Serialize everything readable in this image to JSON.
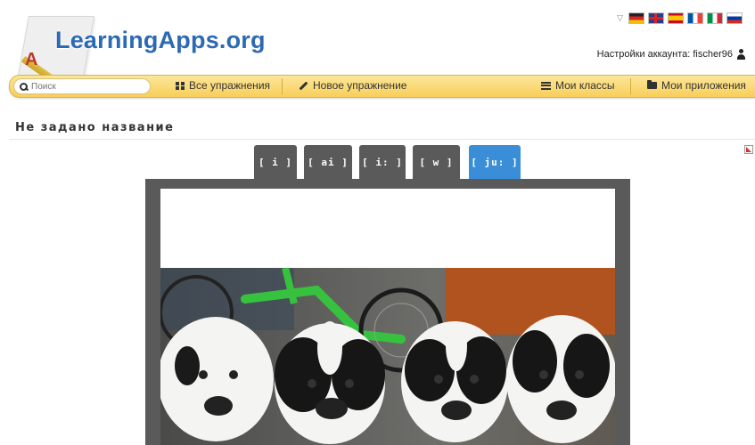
{
  "header": {
    "logo_text": "LearningApps.org",
    "account_label": "Настройки аккаунта: fischer96",
    "languages": [
      "de",
      "en",
      "es",
      "fr",
      "it",
      "ru"
    ]
  },
  "nav": {
    "search_placeholder": "Поиск",
    "all_exercises": "Все упражнения",
    "new_exercise": "Новое упражнение",
    "my_classes": "Мои классы",
    "my_apps": "Мои приложения"
  },
  "page": {
    "title": "Не задано название"
  },
  "app": {
    "tabs": [
      {
        "label": "[ i ]",
        "active": false
      },
      {
        "label": "[ ai ]",
        "active": false
      },
      {
        "label": "[ i: ]",
        "active": false
      },
      {
        "label": "[ w ]",
        "active": false
      },
      {
        "label": "[ ju: ]",
        "active": true
      }
    ],
    "image": "puppies-photo"
  },
  "colors": {
    "navbar": "#f7cf5a",
    "logo_blue": "#2c6ab3",
    "tab_inactive": "#5a5a5a",
    "tab_active": "#3a8ed8"
  }
}
